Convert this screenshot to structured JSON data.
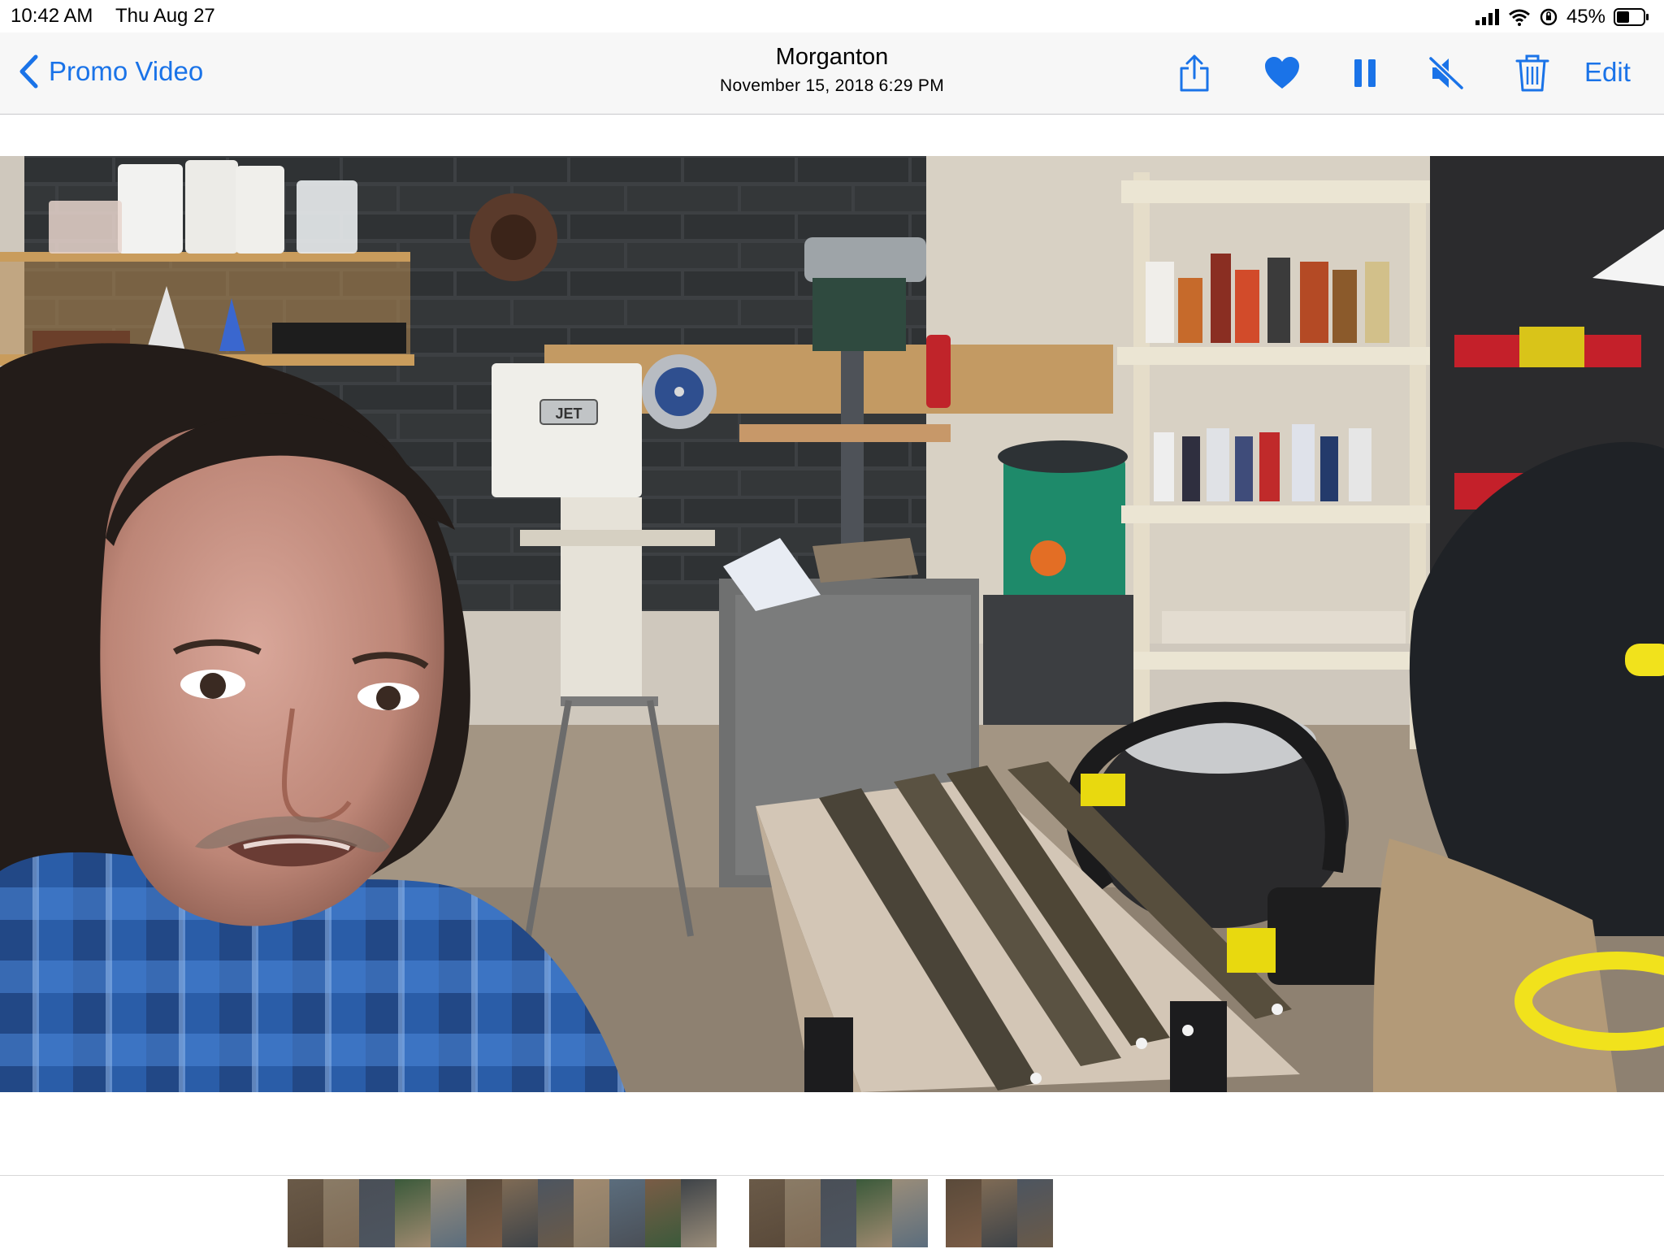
{
  "status_bar": {
    "time": "10:42 AM",
    "date": "Thu Aug 27",
    "battery_percent": "45%"
  },
  "nav": {
    "back_label": "Promo Video",
    "title": "Morganton",
    "subtitle": "November 15, 2018  6:29 PM",
    "edit_label": "Edit"
  },
  "toolbar": {
    "icons": [
      "share-icon",
      "heart-icon",
      "pause-icon",
      "mute-icon",
      "trash-icon"
    ]
  },
  "photo": {
    "brand_label": "JET"
  },
  "colors": {
    "accent": "#1a73e8",
    "nav_background": "#f7f7f7"
  },
  "filmstrip": {
    "group_sizes": [
      12,
      5,
      3
    ]
  }
}
